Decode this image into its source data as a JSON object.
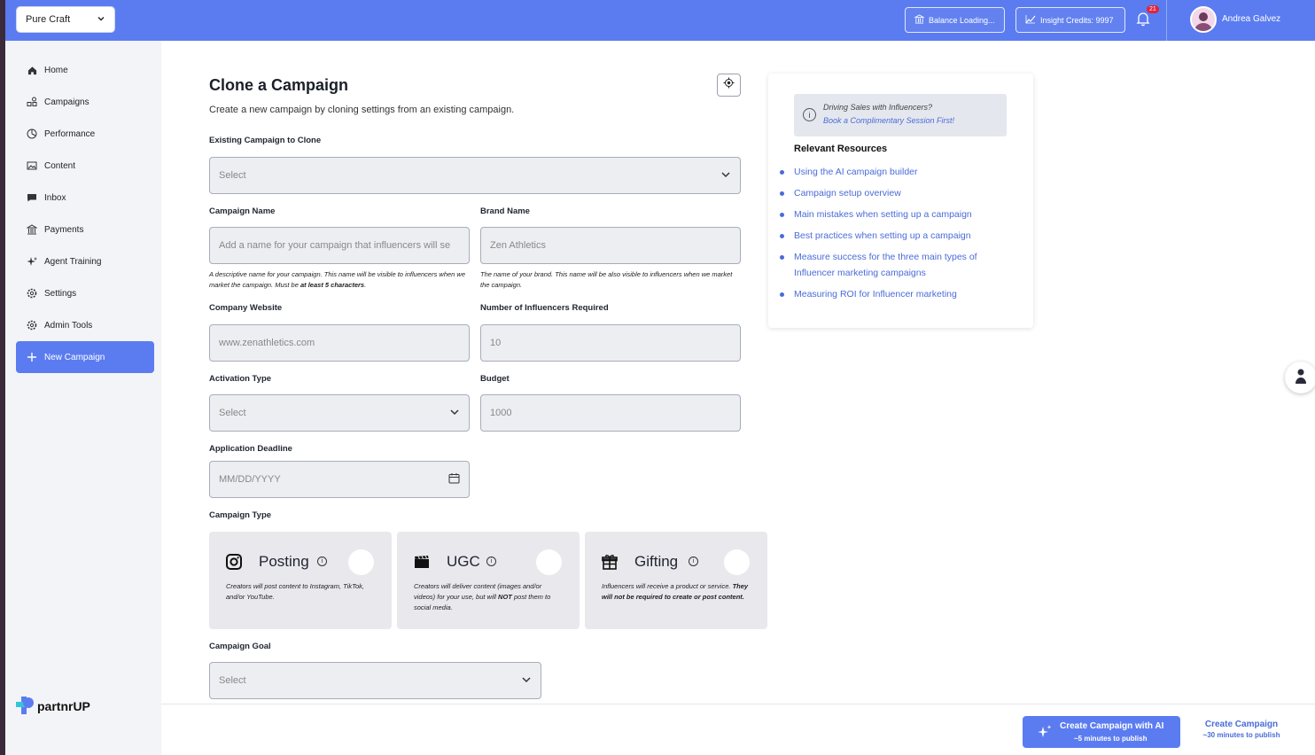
{
  "topbar": {
    "brand_select": "Pure Craft",
    "balance_label": "Balance Loading...",
    "insight_label": "Insight Credits: 9997",
    "notifications_count": "21",
    "user_name": "Andrea Galvez"
  },
  "sidebar": {
    "items": [
      {
        "label": "Home",
        "icon": "home-icon"
      },
      {
        "label": "Campaigns",
        "icon": "campaigns-icon"
      },
      {
        "label": "Performance",
        "icon": "performance-icon"
      },
      {
        "label": "Content",
        "icon": "image-icon"
      },
      {
        "label": "Inbox",
        "icon": "chat-icon"
      },
      {
        "label": "Payments",
        "icon": "bank-icon"
      },
      {
        "label": "Agent Training",
        "icon": "sparkle-icon"
      },
      {
        "label": "Settings",
        "icon": "gear-icon"
      },
      {
        "label": "Admin Tools",
        "icon": "admin-gear-icon"
      },
      {
        "label": "New Campaign",
        "icon": "plus-icon"
      }
    ],
    "logo_text": "partnrUP"
  },
  "form": {
    "title": "Clone a Campaign",
    "subtitle": "Create a new campaign by cloning settings from an existing campaign.",
    "existing_label": "Existing Campaign to Clone",
    "existing_value": "Select",
    "campaign_name_label": "Campaign Name",
    "campaign_name_placeholder": "Add a name for your campaign that influencers will se",
    "campaign_name_hint_a": "A descriptive name for your campaign. This name will be visible to influencers when we market the campaign. Must be ",
    "campaign_name_hint_b": "at least 5 characters",
    "brand_name_label": "Brand Name",
    "brand_name_placeholder": "Zen Athletics",
    "brand_name_hint": "The name of your brand. This name will be also visible to influencers when we market the campaign.",
    "website_label": "Company Website",
    "website_placeholder": "www.zenathletics.com",
    "influencers_label": "Number of Influencers Required",
    "influencers_placeholder": "10",
    "activation_label": "Activation Type",
    "activation_value": "Select",
    "budget_label": "Budget",
    "budget_placeholder": "1000",
    "deadline_label": "Application Deadline",
    "deadline_placeholder": "MM/DD/YYYY",
    "campaign_type_label": "Campaign Type",
    "campaign_types": [
      {
        "title": "Posting",
        "icon": "instagram-icon",
        "desc_plain": "Creators will post content to Instagram, TikTok, and/or YouTube.",
        "desc_bold": "",
        "desc_bold2": ""
      },
      {
        "title": "UGC",
        "icon": "clapperboard-icon",
        "desc_plain": "Creators will deliver content (images and/or videos) for your use, but will ",
        "desc_bold": "NOT",
        "desc_bold2": " post them to social media."
      },
      {
        "title": "Gifting",
        "icon": "gift-icon",
        "desc_plain": "Influencers will receive a product or service. ",
        "desc_bold": "They will not be required to create or post content.",
        "desc_bold2": ""
      }
    ],
    "goal_label": "Campaign Goal",
    "goal_value": "Select"
  },
  "resources": {
    "promo_line1": "Driving Sales with Influencers?",
    "promo_line2": "Book a Complimentary Session First!",
    "title": "Relevant Resources",
    "links": [
      "Using the AI campaign builder",
      "Campaign setup overview",
      "Main mistakes when setting up a campaign",
      "Best practices when setting up a campaign",
      "Measure success for the three main types of Influencer marketing campaigns",
      "Measuring ROI for Influencer marketing"
    ]
  },
  "bottom": {
    "ai_label": "Create Campaign with AI",
    "ai_sub": "~5 minutes to publish",
    "manual_label": "Create Campaign",
    "manual_sub": "~30 minutes to publish"
  },
  "colors": {
    "accent": "#5b7cf0",
    "link": "#4a6bd8"
  }
}
